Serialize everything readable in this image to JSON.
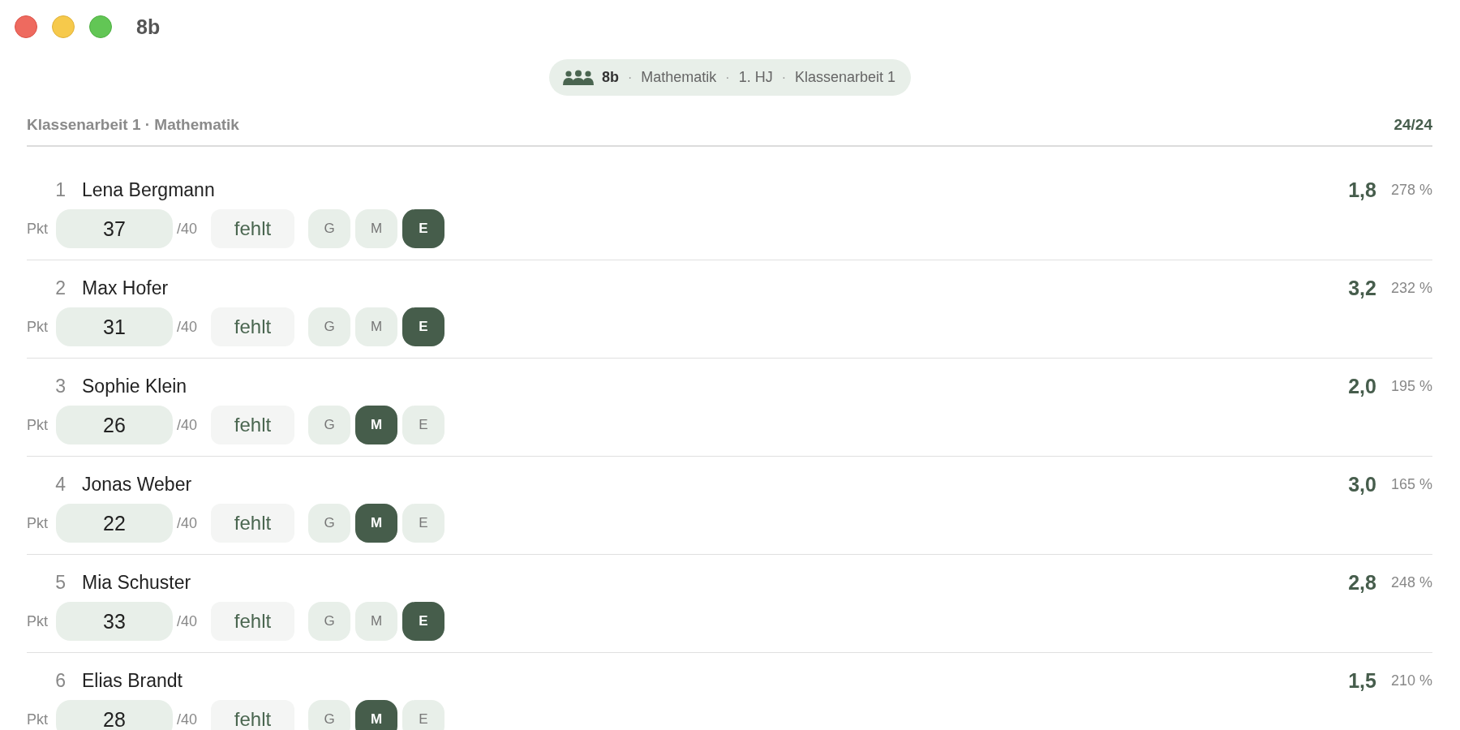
{
  "window": {
    "title": "8b"
  },
  "breadcrumb": {
    "separator": "·",
    "items": [
      {
        "text": "8b",
        "kind": "class"
      },
      {
        "text": "Mathematik",
        "kind": "context"
      },
      {
        "text": "1. HJ",
        "kind": "context"
      },
      {
        "text": "Klassenarbeit 1",
        "kind": "context"
      }
    ]
  },
  "header": {
    "title": "Klassenarbeit 1 · Mathematik",
    "count": "24/24"
  },
  "rows": [
    {
      "number": "1",
      "name": "Lena Bergmann",
      "grade": "1,8",
      "percent": "278 %",
      "points_label": "Pkt",
      "points": "37",
      "max": "/40",
      "absent_label": "fehlt",
      "levels": [
        {
          "label": "G",
          "selected": false
        },
        {
          "label": "M",
          "selected": false
        },
        {
          "label": "E",
          "selected": true
        }
      ]
    },
    {
      "number": "2",
      "name": "Max Hofer",
      "grade": "3,2",
      "percent": "232 %",
      "points_label": "Pkt",
      "points": "31",
      "max": "/40",
      "absent_label": "fehlt",
      "levels": [
        {
          "label": "G",
          "selected": false
        },
        {
          "label": "M",
          "selected": false
        },
        {
          "label": "E",
          "selected": true
        }
      ]
    },
    {
      "number": "3",
      "name": "Sophie Klein",
      "grade": "2,0",
      "percent": "195 %",
      "points_label": "Pkt",
      "points": "26",
      "max": "/40",
      "absent_label": "fehlt",
      "levels": [
        {
          "label": "G",
          "selected": false
        },
        {
          "label": "M",
          "selected": true
        },
        {
          "label": "E",
          "selected": false
        }
      ]
    },
    {
      "number": "4",
      "name": "Jonas Weber",
      "grade": "3,0",
      "percent": "165 %",
      "points_label": "Pkt",
      "points": "22",
      "max": "/40",
      "absent_label": "fehlt",
      "levels": [
        {
          "label": "G",
          "selected": false
        },
        {
          "label": "M",
          "selected": true
        },
        {
          "label": "E",
          "selected": false
        }
      ]
    },
    {
      "number": "5",
      "name": "Mia Schuster",
      "grade": "2,8",
      "percent": "248 %",
      "points_label": "Pkt",
      "points": "33",
      "max": "/40",
      "absent_label": "fehlt",
      "levels": [
        {
          "label": "G",
          "selected": false
        },
        {
          "label": "M",
          "selected": false
        },
        {
          "label": "E",
          "selected": true
        }
      ]
    },
    {
      "number": "6",
      "name": "Elias Brandt",
      "grade": "1,5",
      "percent": "210 %",
      "points_label": "Pkt",
      "points": "28",
      "max": "/40",
      "absent_label": "fehlt",
      "levels": [
        {
          "label": "G",
          "selected": false
        },
        {
          "label": "M",
          "selected": true
        },
        {
          "label": "E",
          "selected": false
        }
      ]
    }
  ]
}
